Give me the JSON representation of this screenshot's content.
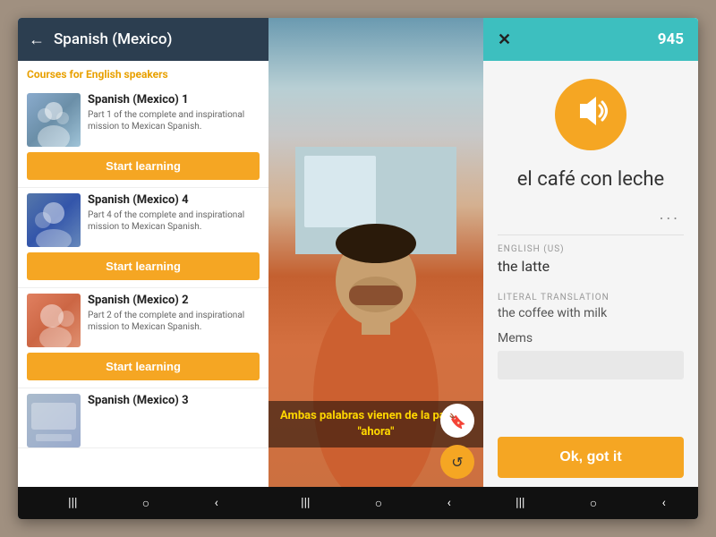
{
  "left": {
    "header": {
      "back_icon": "←",
      "title": "Spanish (Mexico)"
    },
    "subtitle_prefix": "Courses for ",
    "subtitle_lang": "English",
    "subtitle_suffix": " speakers",
    "courses": [
      {
        "title": "Spanish (Mexico) 1",
        "desc": "Part 1 of the complete and inspirational mission to Mexican Spanish.",
        "thumb_class": "thumb-1",
        "btn_label": "Start learning"
      },
      {
        "title": "Spanish (Mexico) 4",
        "desc": "Part 4 of the complete and inspirational mission to Mexican Spanish.",
        "thumb_class": "thumb-2",
        "btn_label": "Start learning"
      },
      {
        "title": "Spanish (Mexico) 2",
        "desc": "Part 2 of the complete and inspirational mission to Mexican Spanish.",
        "thumb_class": "thumb-3",
        "btn_label": "Start learning"
      },
      {
        "title": "Spanish (Mexico) 3",
        "desc": "",
        "thumb_class": "thumb-4",
        "btn_label": ""
      }
    ],
    "nav": [
      "|||",
      "○",
      "<"
    ]
  },
  "middle": {
    "subtitle": "Ambas palabras vienen de la palabra \"ahora\"",
    "nav": [
      "|||",
      "○",
      "<"
    ]
  },
  "right": {
    "header": {
      "close_icon": "✕",
      "score": "945"
    },
    "phrase": "el café con leche",
    "dots": "...",
    "english_label": "ENGLISH (US)",
    "english_value": "the latte",
    "literal_label": "LITERAL TRANSLATION",
    "literal_value": "the coffee with milk",
    "mems_label": "Mems",
    "ok_label": "Ok, got it",
    "nav": [
      "|||",
      "○",
      "<"
    ]
  }
}
